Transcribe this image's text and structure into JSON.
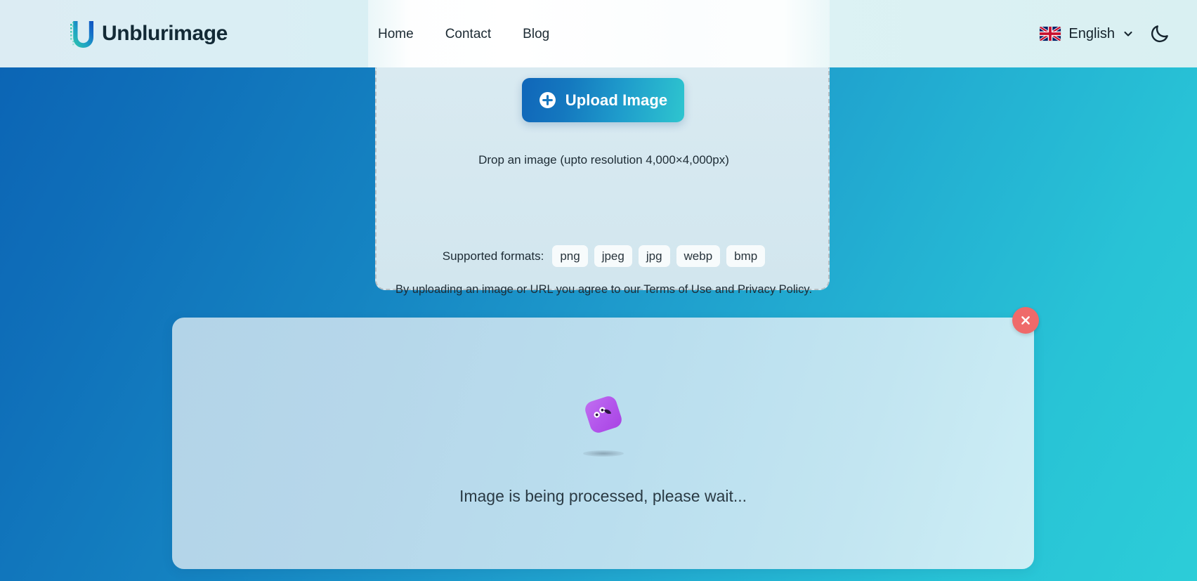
{
  "header": {
    "brand_name": "Unblurimage",
    "logo_icon": "unblurimage-u-logo",
    "nav": [
      {
        "label": "Home",
        "name": "nav-link-home"
      },
      {
        "label": "Contact",
        "name": "nav-link-contact"
      },
      {
        "label": "Blog",
        "name": "nav-link-blog"
      }
    ],
    "language": {
      "label": "English",
      "flag_icon": "uk-flag-icon",
      "chevron_icon": "chevron-down-icon"
    },
    "theme_toggle_icon": "moon-icon"
  },
  "dropzone": {
    "upload_button_label": "Upload Image",
    "upload_button_icon": "plus-circle-icon",
    "drop_hint": "Drop an image (upto resolution 4,000×4,000px)",
    "formats_label": "Supported formats:",
    "formats": [
      "png",
      "jpeg",
      "jpg",
      "webp",
      "bmp"
    ],
    "terms_text": "By uploading an image or URL you agree to our Terms of Use and Privacy Policy."
  },
  "processing": {
    "status_text": "Image is being processed, please wait...",
    "loader_icon": "bouncing-cube-loader",
    "close_button_icon": "close-x-icon"
  },
  "colors": {
    "page_gradient_start": "#0b63b4",
    "page_gradient_end": "#2ccdd8",
    "header_background": "#dbeff3",
    "accent_blue": "#1066b9",
    "accent_teal": "#2ec5cf",
    "close_button": "#ef6a6a",
    "loader_purple": "#b457ec",
    "card_background": "#bddfee"
  }
}
